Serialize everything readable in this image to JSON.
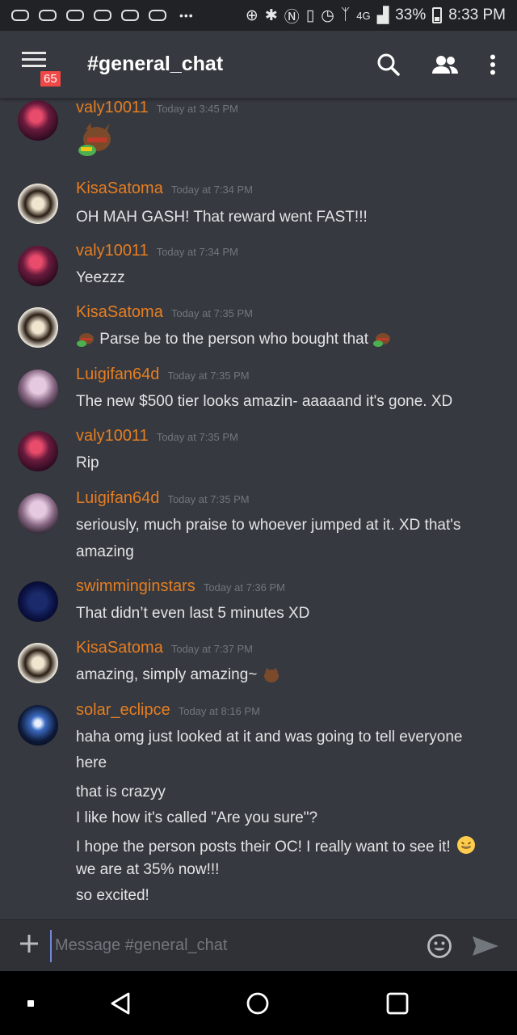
{
  "status_bar": {
    "network": "4G",
    "battery": "33%",
    "time": "8:33 PM"
  },
  "header": {
    "channel": "#general_chat",
    "badge_count": "65"
  },
  "messages": [
    {
      "author": "valy10011",
      "timestamp": "Today at 3:45 PM",
      "lines": []
    },
    {
      "author": "KisaSatoma",
      "timestamp": "Today at 7:34 PM",
      "lines": [
        "OH MAH GASH! That reward went FAST!!!"
      ]
    },
    {
      "author": "valy10011",
      "timestamp": "Today at 7:34 PM",
      "lines": [
        "Yeezzz"
      ]
    },
    {
      "author": "KisaSatoma",
      "timestamp": "Today at 7:35 PM",
      "lines": [
        "Parse be to the person who bought that"
      ]
    },
    {
      "author": "Luigifan64d",
      "timestamp": "Today at 7:35 PM",
      "lines": [
        "The new $500 tier looks amazin- aaaaand it's gone. XD"
      ]
    },
    {
      "author": "valy10011",
      "timestamp": "Today at 7:35 PM",
      "lines": [
        "Rip"
      ]
    },
    {
      "author": "Luigifan64d",
      "timestamp": "Today at 7:35 PM",
      "lines": [
        "seriously, much praise to whoever jumped at it. XD that's",
        "amazing"
      ]
    },
    {
      "author": "swimminginstars",
      "timestamp": "Today at 7:36 PM",
      "lines": [
        "That didn’t even last 5 minutes XD"
      ]
    },
    {
      "author": "KisaSatoma",
      "timestamp": "Today at 7:37 PM",
      "lines": [
        "amazing, simply amazing~"
      ]
    },
    {
      "author": "solar_eclipce",
      "timestamp": "Today at 8:16 PM",
      "lines": [
        "haha omg just looked at it and was going to tell everyone",
        "here",
        "that is crazyy",
        "I like how it's called \"Are you sure\"?",
        "I hope the person posts their OC! I really want to see it!",
        "we are at 35% now!!!",
        "so excited!"
      ]
    }
  ],
  "composer": {
    "placeholder": "Message #general_chat"
  },
  "colors": {
    "background": "#36393f",
    "author": "#e67e22",
    "timestamp": "#72767d",
    "badge": "#f04747"
  }
}
